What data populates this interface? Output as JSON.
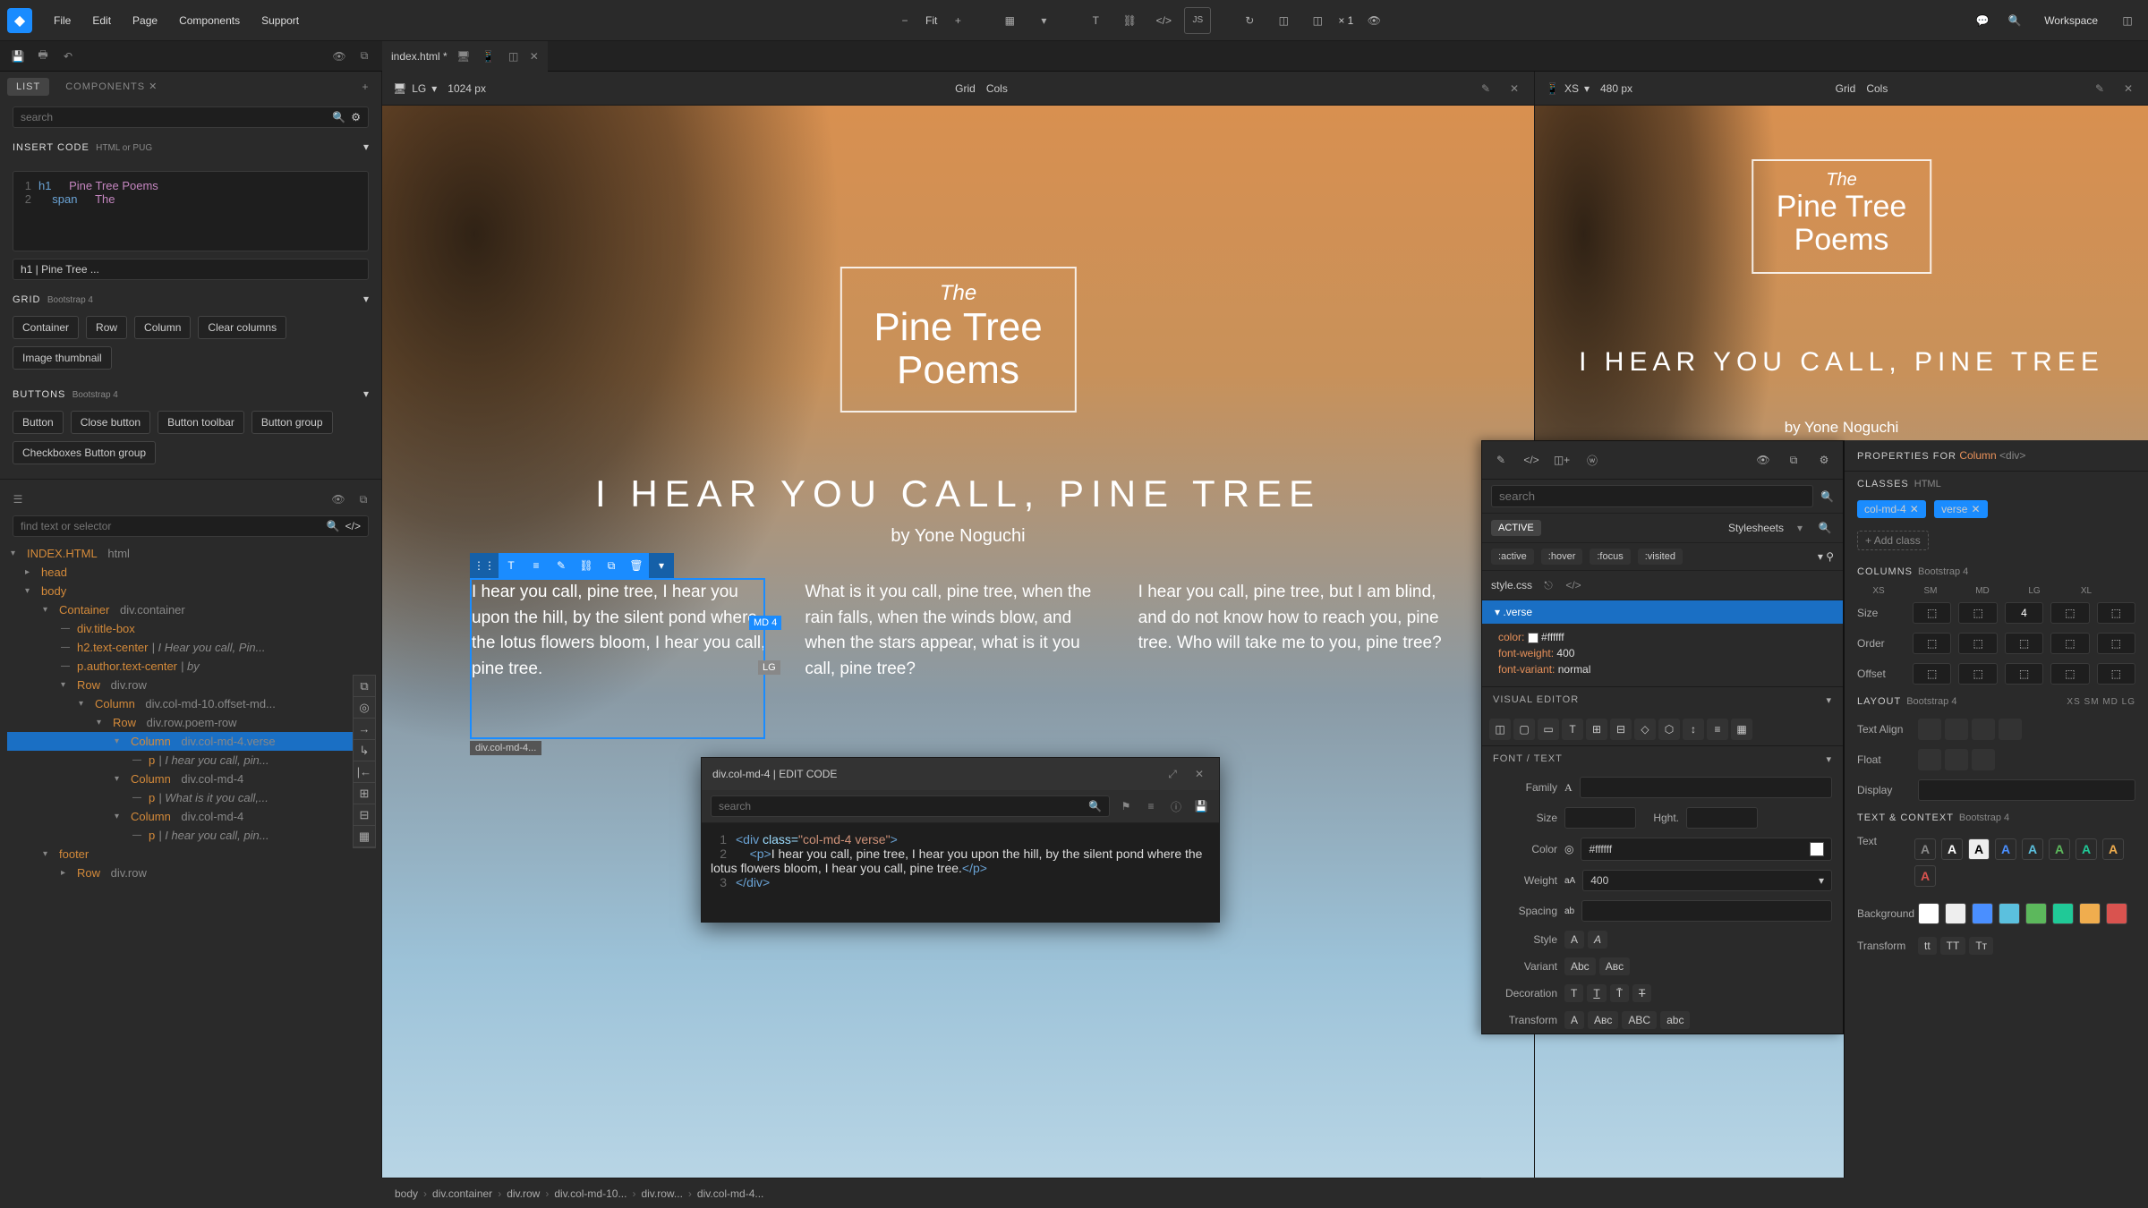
{
  "menubar": {
    "items": [
      "File",
      "Edit",
      "Page",
      "Components",
      "Support"
    ],
    "fit": "Fit",
    "mult": "× 1",
    "workspace": "Workspace"
  },
  "tabbar": {
    "file": "index.html *"
  },
  "left": {
    "tabs": {
      "list": "LIST",
      "components": "COMPONENTS"
    },
    "search_ph": "search",
    "insert": {
      "label": "INSERT CODE",
      "sub": "HTML or PUG"
    },
    "code": {
      "l1a": "h1",
      "l1b": "Pine Tree Poems",
      "l2a": "span",
      "l2b": "The"
    },
    "preview": "h1 | Pine Tree ...",
    "grid": {
      "label": "GRID",
      "sub": "Bootstrap 4",
      "chips": [
        "Container",
        "Row",
        "Column",
        "Clear columns",
        "Image thumbnail"
      ]
    },
    "buttons": {
      "label": "BUTTONS",
      "sub": "Bootstrap 4",
      "chips": [
        "Button",
        "Close button",
        "Button toolbar",
        "Button group",
        "Checkboxes Button group"
      ]
    },
    "tree_search_ph": "find text or selector",
    "tree": {
      "root": "INDEX.HTML",
      "root_ext": "html",
      "items": [
        {
          "d": 1,
          "a": "▸",
          "t": "head"
        },
        {
          "d": 1,
          "a": "▾",
          "t": "body"
        },
        {
          "d": 2,
          "a": "▾",
          "t": "Container",
          "c": "div.container"
        },
        {
          "d": 3,
          "a": "",
          "t": "div.title-box"
        },
        {
          "d": 3,
          "a": "",
          "t": "h2.text-center",
          "x": " | I Hear you call, Pin..."
        },
        {
          "d": 3,
          "a": "",
          "t": "p.author.text-center",
          "x": " | by"
        },
        {
          "d": 3,
          "a": "▾",
          "t": "Row",
          "c": "div.row"
        },
        {
          "d": 4,
          "a": "▾",
          "t": "Column",
          "c": "div.col-md-10.offset-md..."
        },
        {
          "d": 5,
          "a": "▾",
          "t": "Row",
          "c": "div.row.poem-row"
        },
        {
          "d": 6,
          "a": "▾",
          "t": "Column",
          "c": "div.col-md-4.verse",
          "sel": true
        },
        {
          "d": 7,
          "a": "",
          "t": "p",
          "x": " | I hear you call, pin..."
        },
        {
          "d": 6,
          "a": "▾",
          "t": "Column",
          "c": "div.col-md-4"
        },
        {
          "d": 7,
          "a": "",
          "t": "p",
          "x": " | What is it you call,..."
        },
        {
          "d": 6,
          "a": "▾",
          "t": "Column",
          "c": "div.col-md-4"
        },
        {
          "d": 7,
          "a": "",
          "t": "p",
          "x": " | I hear you call, pin..."
        },
        {
          "d": 2,
          "a": "▾",
          "t": "footer"
        },
        {
          "d": 3,
          "a": "▸",
          "t": "Row",
          "c": "div.row"
        }
      ]
    }
  },
  "viewports": {
    "lg": {
      "label": "LG",
      "px": "1024 px",
      "grid": "Grid",
      "cols": "Cols"
    },
    "xs": {
      "label": "XS",
      "px": "480 px",
      "grid": "Grid",
      "cols": "Cols"
    }
  },
  "poem": {
    "the": "The",
    "title": "Pine Tree Poems",
    "h1": "I HEAR YOU CALL, PINE TREE",
    "author": "by Yone Noguchi",
    "v1": "I hear you call, pine tree, I hear you upon the hill, by the silent pond where the lotus flowers bloom, I hear you call, pine tree.",
    "v2": "What is it you call, pine tree, when the rain falls, when the winds blow, and when the stars appear, what is it you call, pine tree?",
    "v3": "I hear you call, pine tree, but I am blind, and do not know how to reach you, pine tree. Who will take me to you, pine tree?",
    "badge_md": "MD 4",
    "badge_lg": "LG",
    "sel_label": "div.col-md-4..."
  },
  "edit_popup": {
    "title": "div.col-md-4 | EDIT CODE",
    "search_ph": "search",
    "code_lines": [
      "<div class=\"col-md-4 verse\">",
      "    <p>I hear you call, pine tree, I hear you upon the hill, by the silent pond where the lotus flowers bloom, I hear you call, pine tree.</p>",
      "</div>"
    ]
  },
  "style_panel": {
    "search_ph": "search",
    "active": "ACTIVE",
    "stylesheets": "Stylesheets",
    "states": [
      ":active",
      ":hover",
      ":focus",
      ":visited"
    ],
    "css_file": "style.css",
    "rule": ".verse",
    "props": [
      {
        "k": "color:",
        "v": "#ffffff"
      },
      {
        "k": "font-weight:",
        "v": "400"
      },
      {
        "k": "font-variant:",
        "v": "normal"
      }
    ],
    "visual": "VISUAL EDITOR",
    "font_sec": "FONT / TEXT",
    "family": "Family",
    "size": "Size",
    "hght": "Hght.",
    "color": "Color",
    "color_v": "#ffffff",
    "weight": "Weight",
    "weight_v": "400",
    "spacing": "Spacing",
    "style": "Style",
    "variant": "Variant",
    "decoration": "Decoration",
    "transform": "Transform",
    "variant_a": "Abc",
    "variant_b": "Aʙᴄ"
  },
  "props_panel": {
    "prop_for": "PROPERTIES FOR",
    "el": "Column",
    "tag": "<div>",
    "classes": "CLASSES",
    "classes_sub": "HTML",
    "chips": [
      "col-md-4",
      "verse"
    ],
    "add": "Add class",
    "columns": "COLUMNS",
    "columns_sub": "Bootstrap 4",
    "bps": [
      "XS",
      "SM",
      "MD",
      "LG",
      "XL"
    ],
    "size": "Size",
    "size_v": "4",
    "order": "Order",
    "offset": "Offset",
    "layout": "LAYOUT",
    "layout_sub": "Bootstrap 4",
    "layout_bps": [
      "XS",
      "SM",
      "MD",
      "LG"
    ],
    "text_align": "Text Align",
    "float": "Float",
    "display": "Display",
    "text_ctx": "TEXT & CONTEXT",
    "text_ctx_sub": "Bootstrap 4",
    "text": "Text",
    "background": "Background",
    "transform2": "Transform"
  },
  "breadcrumb": [
    "body",
    "div.container",
    "div.row",
    "div.col-md-10...",
    "div.row...",
    "div.col-md-4..."
  ]
}
